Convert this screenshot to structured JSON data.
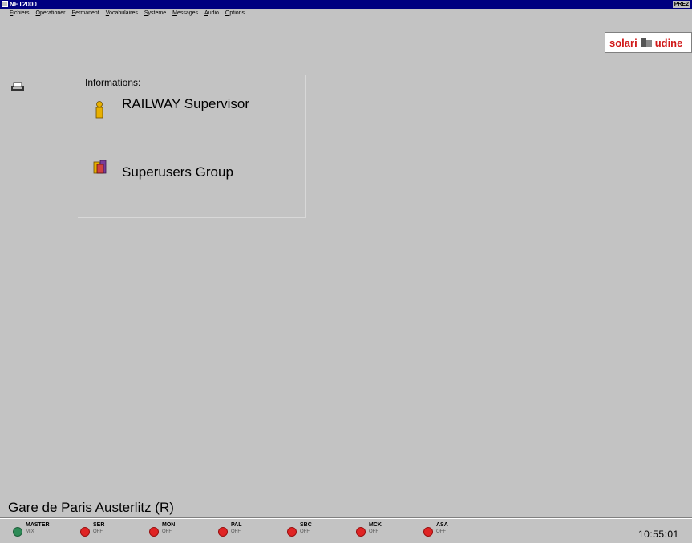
{
  "window": {
    "title": "NET2000",
    "control_label": "PRE2"
  },
  "menu": [
    "Fichiers",
    "Operationer",
    "Permanent",
    "Vocabulaires",
    "Systeme",
    "Messages",
    "Audio",
    "Options"
  ],
  "logo": {
    "left": "solari",
    "right": "udine"
  },
  "info": {
    "heading": "Informations:",
    "user": "RAILWAY Supervisor",
    "group": "Superusers Group"
  },
  "station": "Gare de Paris Austerlitz (R)",
  "status": [
    {
      "name": "MASTER",
      "state": "MIX",
      "color": "#2e8b57",
      "active": true
    },
    {
      "name": "SER",
      "state": "OFF",
      "color": "#e02424",
      "active": false
    },
    {
      "name": "MON",
      "state": "OFF",
      "color": "#e02424",
      "active": false
    },
    {
      "name": "PAL",
      "state": "OFF",
      "color": "#e02424",
      "active": false
    },
    {
      "name": "SBC",
      "state": "OFF",
      "color": "#e02424",
      "active": false
    },
    {
      "name": "MCK",
      "state": "OFF",
      "color": "#e02424",
      "active": false
    },
    {
      "name": "ASA",
      "state": "OFF",
      "color": "#e02424",
      "active": false
    }
  ],
  "clock": "10:55:01",
  "icons": {
    "app": "app-icon",
    "side": "phone-icon",
    "user": "user-icon",
    "group": "group-icon",
    "logo": "solari-logo-icon"
  }
}
